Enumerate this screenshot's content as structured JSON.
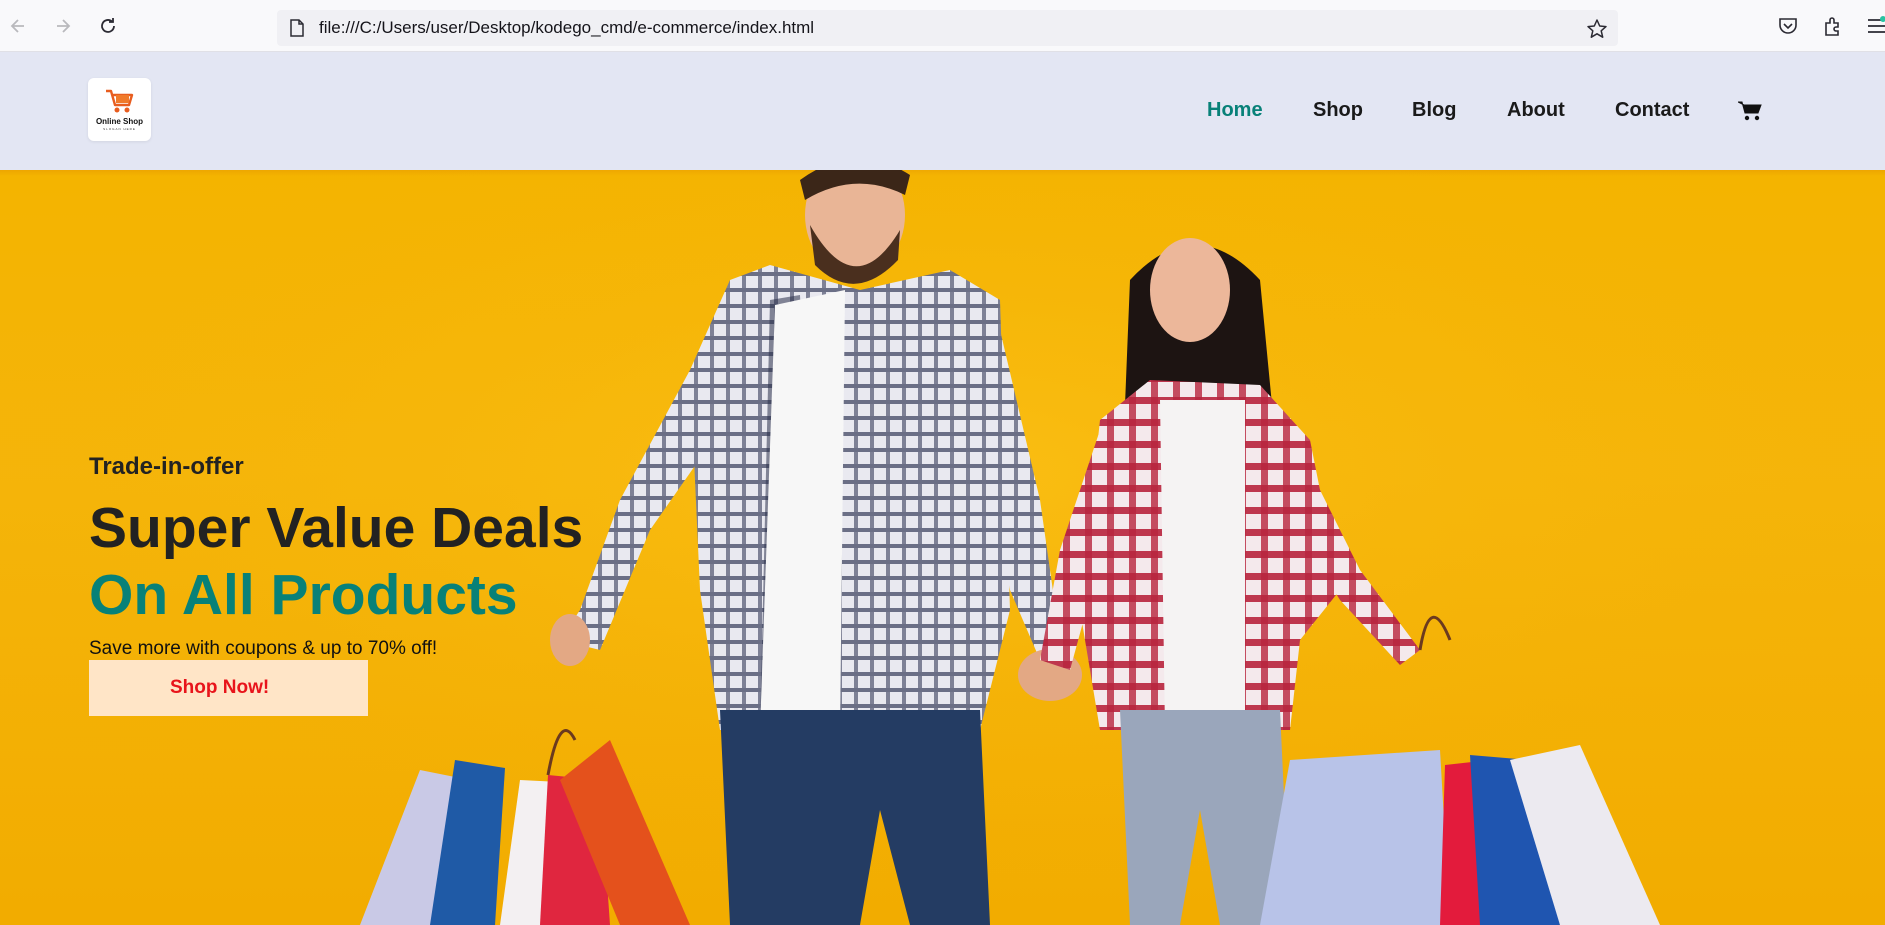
{
  "browser": {
    "url": "file:///C:/Users/user/Desktop/kodego_cmd/e-commerce/index.html",
    "icons": [
      "back-icon",
      "forward-icon",
      "reload-icon",
      "file-icon",
      "bookmark-star-icon",
      "pocket-icon",
      "extensions-icon",
      "menu-icon"
    ]
  },
  "site": {
    "logo": {
      "name": "Online Shop",
      "tagline": "SLOGAN HERE"
    },
    "nav": [
      {
        "label": "Home",
        "active": true
      },
      {
        "label": "Shop",
        "active": false
      },
      {
        "label": "Blog",
        "active": false
      },
      {
        "label": "About",
        "active": false
      },
      {
        "label": "Contact",
        "active": false
      }
    ],
    "cart_icon": "shopping-cart-icon"
  },
  "hero": {
    "kicker": "Trade-in-offer",
    "headline_line1": "Super Value Deals",
    "headline_line2": "On All Products",
    "subtext": "Save more with coupons & up to 70% off!",
    "cta_label": "Shop Now!"
  },
  "colors": {
    "header_bg": "#e3e6f3",
    "accent": "#088178",
    "hero_bg": "#f5b50a",
    "cta_bg": "#ffe5c7",
    "cta_text": "#e8141b"
  }
}
